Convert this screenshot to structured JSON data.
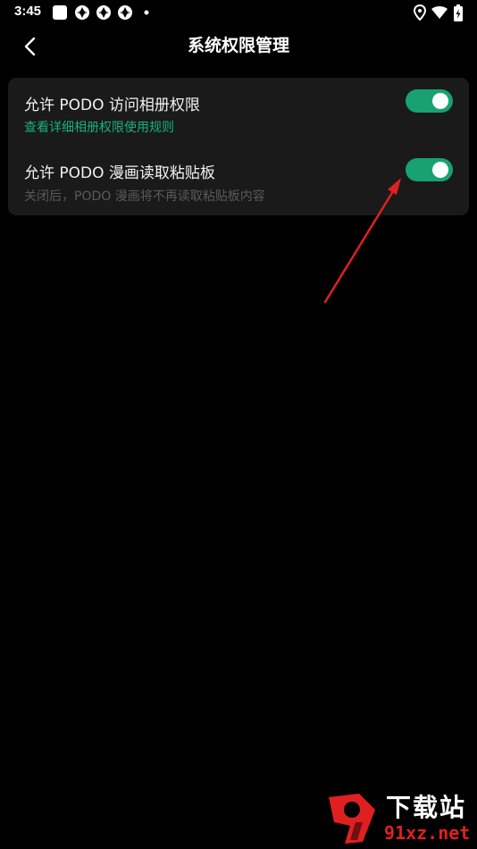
{
  "status_bar": {
    "time": "3:45",
    "icons": [
      "app-square-icon",
      "network-icon",
      "network-icon",
      "network-icon",
      "notification-dot-icon",
      "location-icon",
      "wifi-icon",
      "battery-icon"
    ]
  },
  "header": {
    "title": "系统权限管理",
    "back_icon": "chevron-left-icon"
  },
  "permissions": [
    {
      "title": "允许 PODO 访问相册权限",
      "subtitle": "查看详细相册权限使用规则",
      "enabled": true
    },
    {
      "title": "允许 PODO 漫画读取粘贴板",
      "subtitle": "关闭后，PODO 漫画将不再读取粘贴板内容",
      "enabled": true
    }
  ],
  "watermark": {
    "brand": "下载站",
    "domain": "91xz.net"
  },
  "colors": {
    "background": "#000000",
    "card": "#1a1a1a",
    "accent": "#18a271",
    "link": "#17b07f",
    "muted": "#5a5a5a",
    "arrow": "#e02020"
  }
}
